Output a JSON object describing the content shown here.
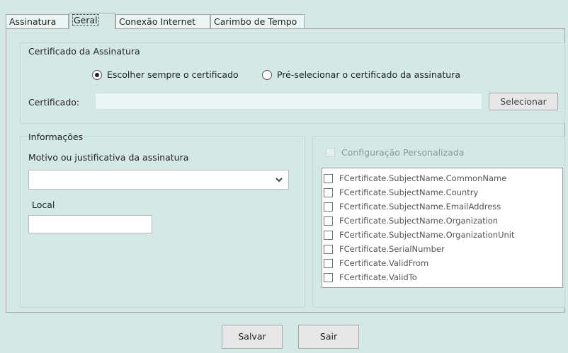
{
  "tabs": [
    {
      "label": "Assinatura",
      "active": false
    },
    {
      "label": "Geral",
      "active": true
    },
    {
      "label": "Conexão Internet",
      "active": false
    },
    {
      "label": "Carimbo de Tempo",
      "active": false
    }
  ],
  "certificado_group": {
    "title": "Certificado da Assinatura",
    "radio_always": "Escolher sempre o certificado",
    "radio_preselect": "Pré-selecionar o certificado da assinatura",
    "selected_option": "Escolher sempre o certificado",
    "field_label": "Certificado:",
    "field_value": "",
    "select_button": "Selecionar"
  },
  "info_group": {
    "title": "Informações",
    "reason_label": "Motivo ou justificativa da assinatura",
    "reason_value": "",
    "location_label": "Local",
    "location_value": ""
  },
  "custom_group": {
    "checkbox_label": "Configuração Personalizada",
    "checked": false,
    "items": [
      "FCertificate.SubjectName.CommonName",
      "FCertificate.SubjectName.Country",
      "FCertificate.SubjectName.EmailAddress",
      "FCertificate.SubjectName.Organization",
      "FCertificate.SubjectName.OrganizationUnit",
      "FCertificate.SerialNumber",
      "FCertificate.ValidFrom",
      "FCertificate.ValidTo"
    ]
  },
  "footer": {
    "save_label": "Salvar",
    "exit_label": "Sair"
  },
  "icons": {
    "dropdown": "chevron-down-icon"
  }
}
